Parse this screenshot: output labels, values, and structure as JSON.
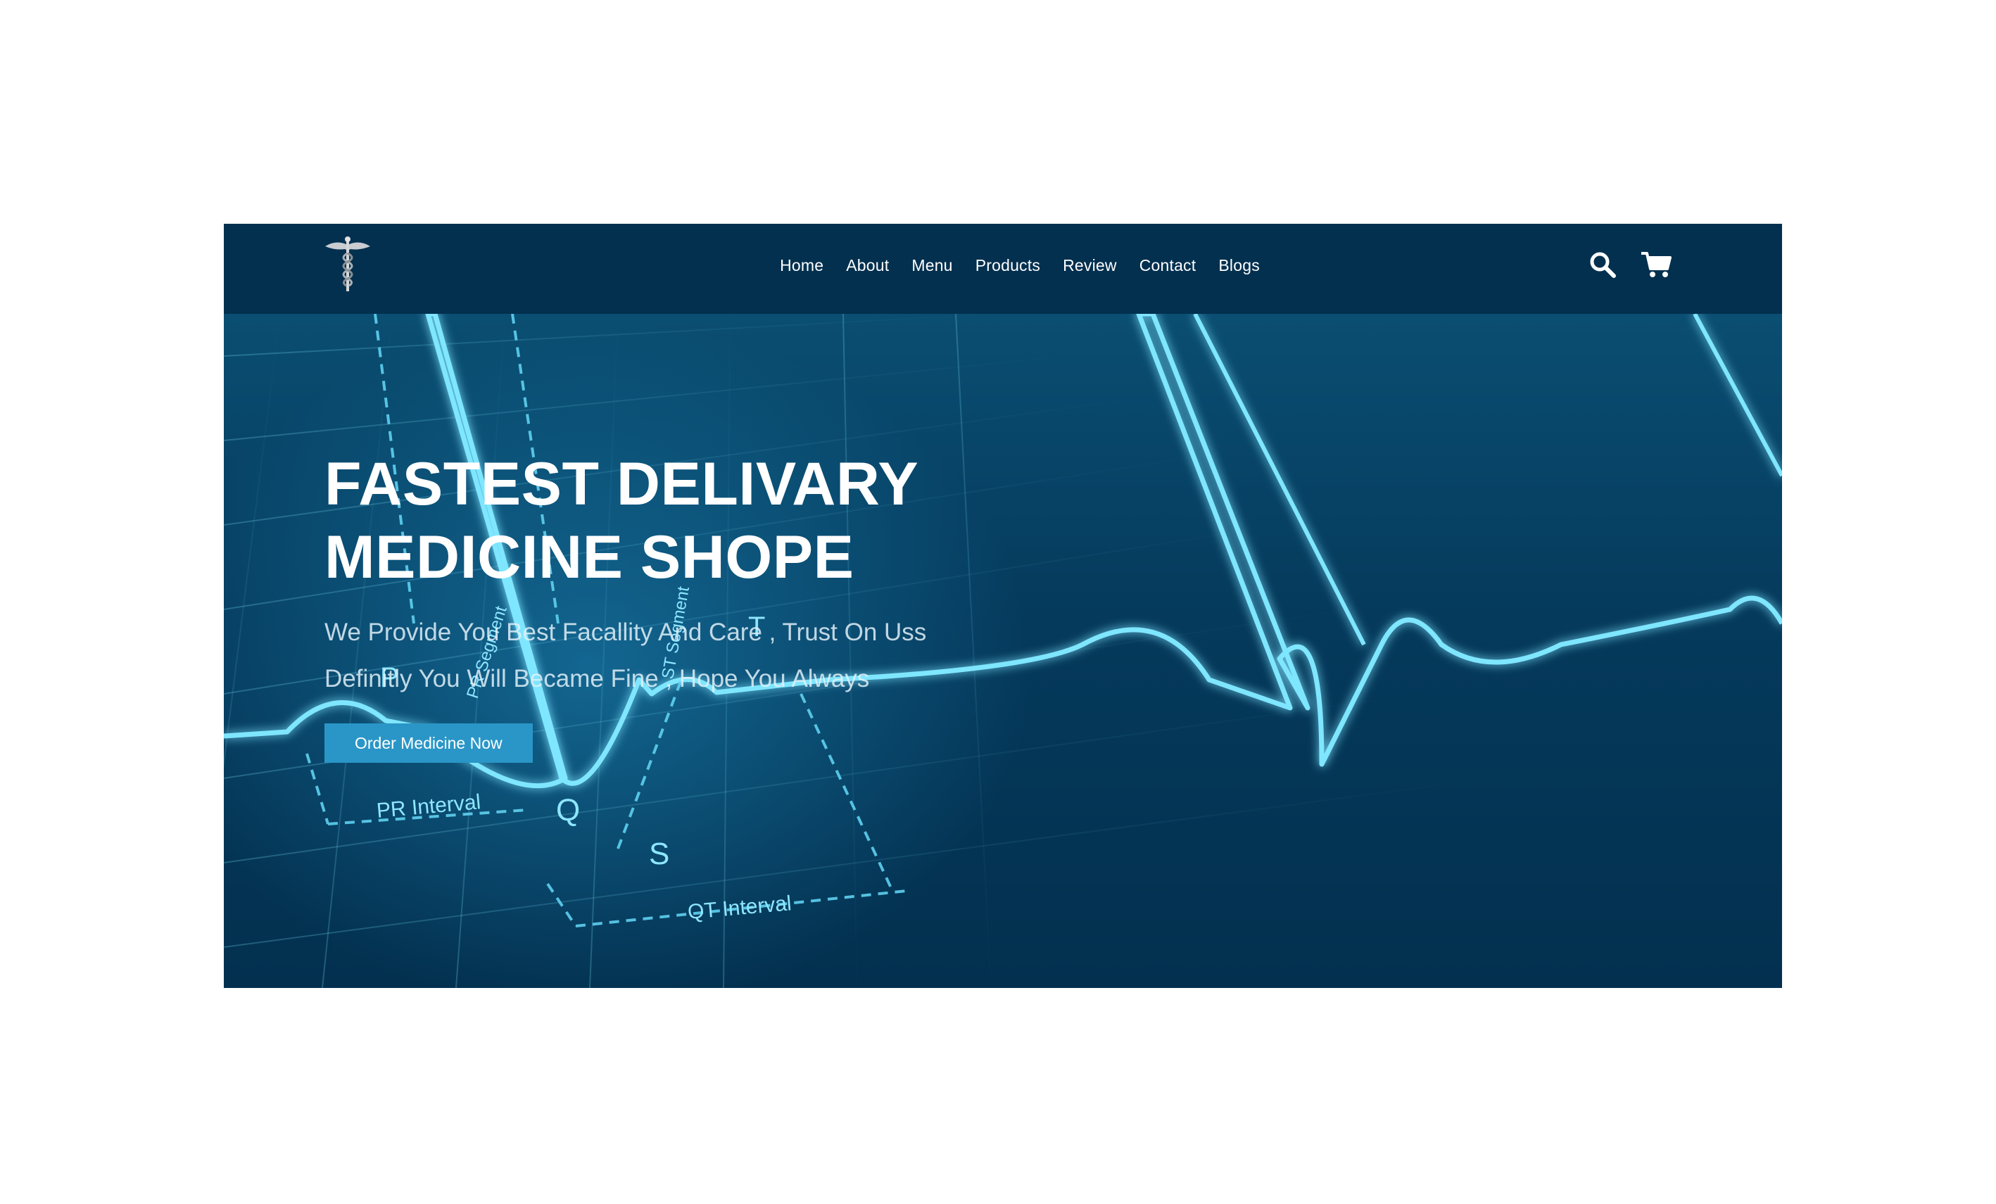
{
  "nav": {
    "logo_icon": "caduceus-icon",
    "links": [
      "Home",
      "About",
      "Menu",
      "Products",
      "Review",
      "Contact",
      "Blogs"
    ],
    "icons": [
      "search-icon",
      "cart-icon"
    ]
  },
  "hero": {
    "title_line1": "FASTEST DELIVARY",
    "title_line2": "MEDICINE SHOPE",
    "subtitle_line1": "We Provide You Best Facallity And Care , Trust On Uss",
    "subtitle_line2": "Definitly You Will Became Fine , Hope You Always",
    "cta_label": "Order Medicine Now"
  },
  "ecg_labels": {
    "p": "P",
    "q": "Q",
    "s": "S",
    "t": "T",
    "pr_interval": "PR Interval",
    "qt_interval": "QT Interval",
    "pr_segment": "PR Segment",
    "st_segment": "ST Segment"
  },
  "colors": {
    "navy": "#03304f",
    "accent": "#2a96c7",
    "glow": "#7fe6ff"
  }
}
